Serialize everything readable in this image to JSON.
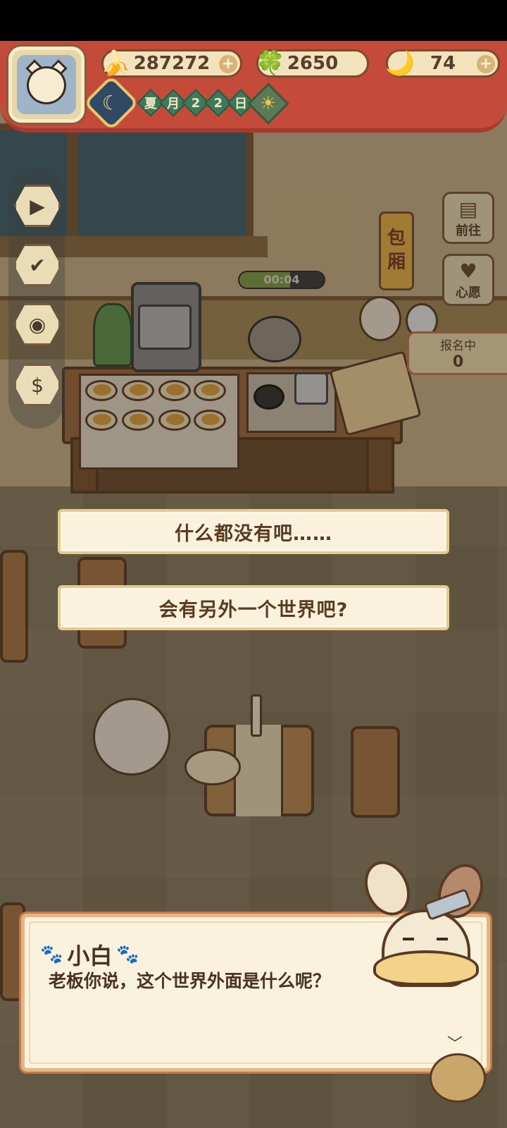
{
  "hud": {
    "currencies": [
      {
        "icon": "banana-icon",
        "value": "287272",
        "plus": "+"
      },
      {
        "icon": "clover-icon",
        "value": "2650",
        "plus": ""
      },
      {
        "icon": "blue-banana-icon",
        "value": "74",
        "plus": "+"
      }
    ],
    "date": {
      "chars": [
        "夏",
        "月",
        "2",
        "2",
        "日"
      ]
    }
  },
  "side_toolbar": {
    "buttons": [
      {
        "icon": "tv-icon"
      },
      {
        "icon": "shop-icon"
      },
      {
        "icon": "camera-icon"
      },
      {
        "icon": "money-icon"
      }
    ]
  },
  "right_panel": {
    "private_room_label": [
      "包",
      "厢"
    ],
    "goto_label": "前往",
    "wish_label": "心愿",
    "signup_label": "报名中",
    "signup_count": "0"
  },
  "cooking": {
    "timer_text": "00:04",
    "timer_progress": 0.6
  },
  "choices": [
    {
      "label": "什么都没有吧……"
    },
    {
      "label": "会有另外一个世界吧?"
    }
  ],
  "dialog": {
    "speaker": "小白",
    "text": "老板你说，这个世界外面是什么呢？"
  },
  "colors": {
    "banner": "#c44a3a",
    "choice_bg": "#fbf2de",
    "text_dark": "#4a3222"
  }
}
